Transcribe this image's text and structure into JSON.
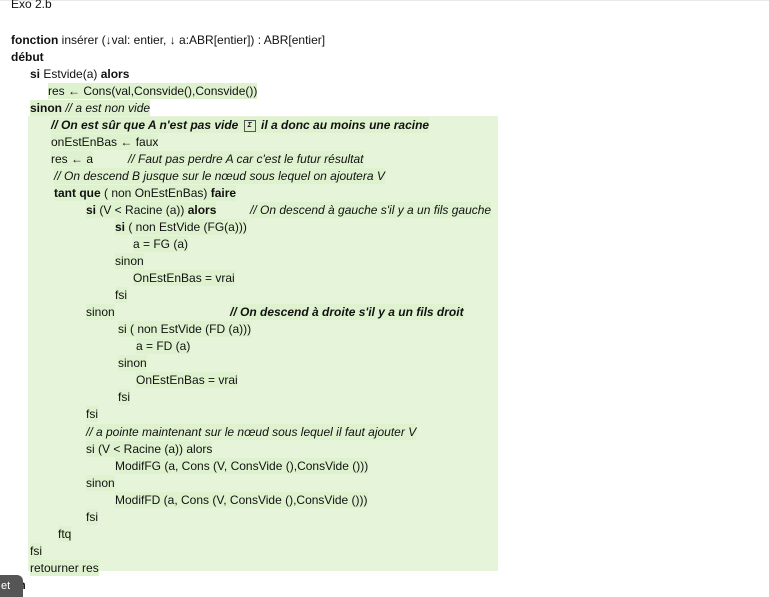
{
  "doc": {
    "header": "Exo 2.b",
    "sig_kw": "fonction",
    "sig_rest": " insérer (↓val: entier, ↓ a:ABR[entier]) : ABR[entier]",
    "debut": "début",
    "si1_kw": "si",
    "si1_cond": " Estvide(a) ",
    "alors1": "alors",
    "res_cons": "res ← Cons(val,Consvide(),Consvide())",
    "sinon1": "sinon",
    "sinon1_comment": " // a est non vide",
    "c_racine_a": "// On est sûr que A n'est pas vide",
    "c_racine_b": "il a donc au moins une racine",
    "inline_icon": "Σ",
    "onestenbas_init": "onEstEnBas ← faux",
    "res_assign": "res ← a",
    "c_perdre": "// Faut pas perdre A car c'est le futur résultat",
    "c_descend": "// On descend B jusque sur le nœud sous lequel on ajoutera V",
    "tq_kw": "tant que",
    "tq_cond": " ( non OnEstEnBas) ",
    "faire": "faire",
    "si2_kw": "si",
    "si2_cond": " (V < Racine (a)) ",
    "alors2": "alors",
    "c_gauche": "// On descend à gauche s'il y a un fils gauche",
    "si3_kw": "si",
    "si3_cond": " ( non EstVide (FG(a)))",
    "a_fg": "a = FG (a)",
    "sinon3": "sinon",
    "oneb1": "OnEstEnBas = vrai",
    "fsi3": "fsi",
    "sinon2": "sinon",
    "c_droite": "// On descend à droite s'il y a un fils droit",
    "si4": "si ( non EstVide (FD (a)))",
    "a_fd": "a = FD (a)",
    "sinon4": "sinon",
    "oneb2": "OnEstEnBas = vrai",
    "fsi4": "fsi",
    "fsi2": "fsi",
    "c_pointe": "// a pointe maintenant sur le nœud sous lequel il faut ajouter V",
    "si5": "si (V < Racine (a)) alors",
    "modif_fg": "ModifFG (a, Cons (V, ConsVide (),ConsVide ()))",
    "sinon5": "sinon",
    "modif_fd": "ModifFD (a, Cons (V, ConsVide (),ConsVide ()))",
    "fsi5": "fsi",
    "ftq": "ftq",
    "fsi1": "fsi",
    "retourner": "retourner res",
    "fin": "fin"
  },
  "overlay": {
    "corner_text": "et"
  }
}
